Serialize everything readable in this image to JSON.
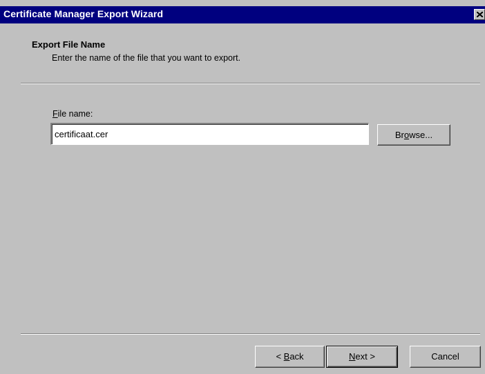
{
  "window": {
    "title": "Certificate Manager Export Wizard"
  },
  "header": {
    "title": "Export File Name",
    "subtitle": "Enter the name of the file that you want to export."
  },
  "form": {
    "file_label_accel": "F",
    "file_label_rest": "ile name:",
    "file_value": "certificaat.cer",
    "browse_pre": "Br",
    "browse_accel": "o",
    "browse_post": "wse..."
  },
  "footer": {
    "back_arrow": "< ",
    "back_accel": "B",
    "back_rest": "ack",
    "next_accel": "N",
    "next_rest": "ext >",
    "cancel_label": "Cancel"
  },
  "icons": {
    "close": "close-icon"
  }
}
